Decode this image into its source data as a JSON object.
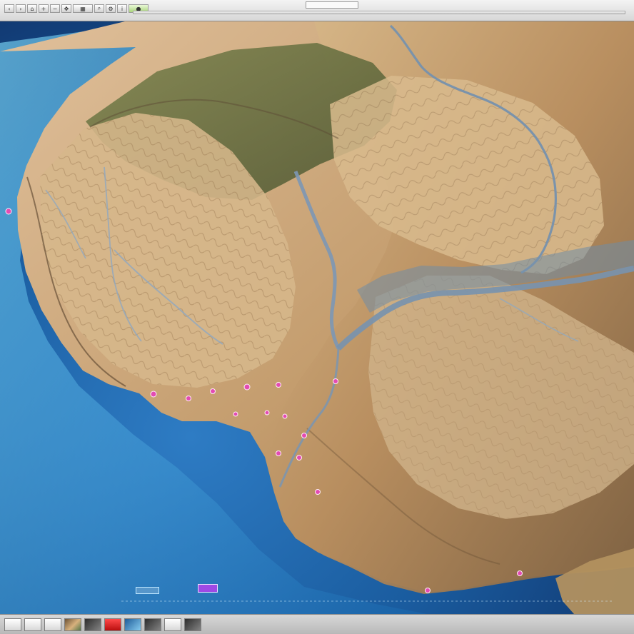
{
  "window": {
    "title": ""
  },
  "toolbar": {
    "tab_label": ""
  },
  "map": {
    "labels": [
      {
        "id": "northwest-label",
        "text": ""
      },
      {
        "id": "northeast-basin-label",
        "text": ""
      },
      {
        "id": "river-confluence-label",
        "text": ""
      },
      {
        "id": "west-coast-label-1",
        "text": ""
      },
      {
        "id": "west-coast-label-2",
        "text": ""
      },
      {
        "id": "west-coast-label-3",
        "text": ""
      },
      {
        "id": "south-coast-label-1",
        "text": ""
      },
      {
        "id": "south-coast-label-2",
        "text": ""
      },
      {
        "id": "south-coast-label-3",
        "text": ""
      },
      {
        "id": "east-coast-label",
        "text": ""
      }
    ],
    "accent": {
      "ocean": "#1d4f8f",
      "shallow_water": "#6ed6ff",
      "land": "#b79163",
      "forest": "#5f7040",
      "river": "#7691ad",
      "marker": "#e34bb3",
      "badge": "#9d49e5"
    }
  },
  "status": {
    "scale_label": "",
    "ocean_badge": ""
  },
  "thumbnails": [
    {
      "icon": "thumbnail-icon"
    },
    {
      "icon": "thumbnail-icon"
    },
    {
      "icon": "thumbnail-icon"
    },
    {
      "icon": "thumbnail-icon"
    },
    {
      "icon": "thumbnail-icon"
    },
    {
      "icon": "thumbnail-icon"
    },
    {
      "icon": "thumbnail-icon"
    },
    {
      "icon": "thumbnail-icon"
    },
    {
      "icon": "thumbnail-icon"
    },
    {
      "icon": "thumbnail-icon"
    }
  ]
}
